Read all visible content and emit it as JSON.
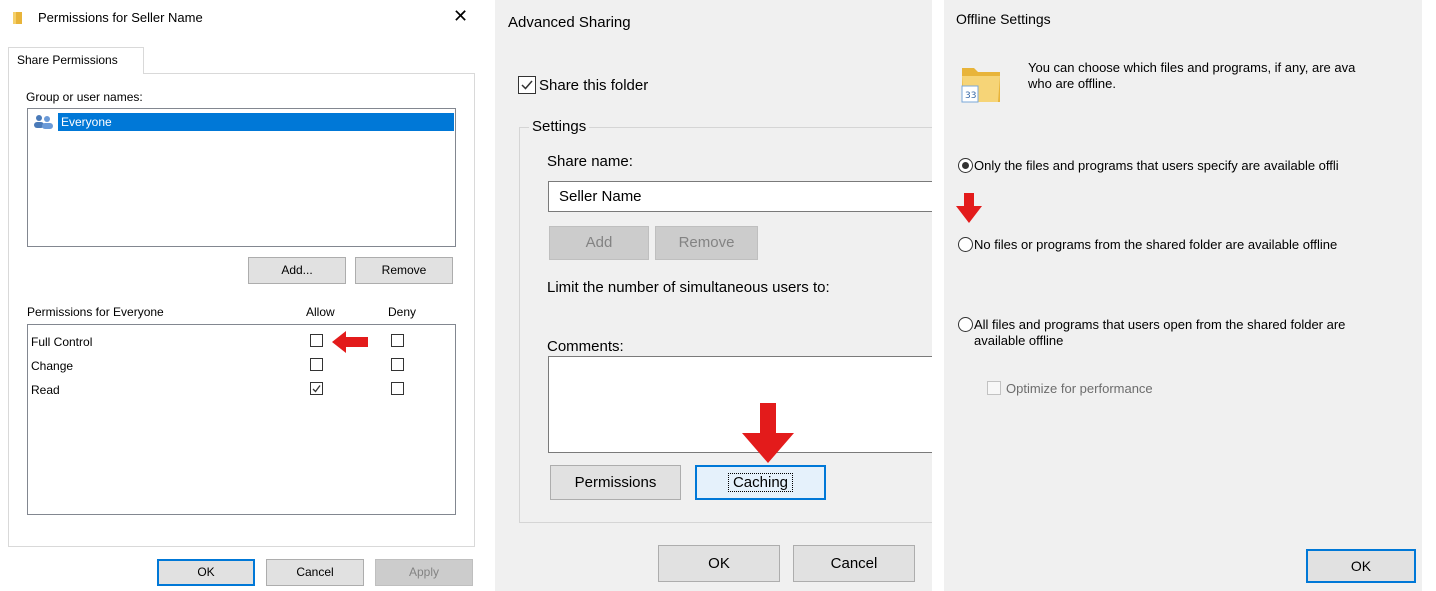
{
  "colors": {
    "accent": "#0078d7",
    "selection": "#0078d7",
    "arrow": "#e31b1b",
    "dialog_bg": "#f0f0f0"
  },
  "permissions_dialog": {
    "title": "Permissions for Seller Name",
    "title_icon": "folder-icon",
    "close_glyph": "✕",
    "tab_label": "Share Permissions",
    "group_label": "Group or user names:",
    "users": [
      {
        "name": "Everyone",
        "icon": "users-icon",
        "selected": true
      }
    ],
    "add_label": "Add...",
    "remove_label": "Remove",
    "perm_header": "Permissions for Everyone",
    "allow_header": "Allow",
    "deny_header": "Deny",
    "perms": [
      {
        "name": "Full Control",
        "allow": false,
        "deny": false
      },
      {
        "name": "Change",
        "allow": false,
        "deny": false
      },
      {
        "name": "Read",
        "allow": true,
        "deny": false
      }
    ],
    "ok_label": "OK",
    "cancel_label": "Cancel",
    "apply_label": "Apply"
  },
  "advanced_sharing": {
    "title": "Advanced Sharing",
    "share_checkbox_label": "Share this folder",
    "share_checked": true,
    "settings_label": "Settings",
    "share_name_label": "Share name:",
    "share_name_value": "Seller Name",
    "add_label": "Add",
    "remove_label": "Remove",
    "limit_label": "Limit the number of simultaneous users to:",
    "comments_label": "Comments:",
    "comments_value": "",
    "permissions_label": "Permissions",
    "caching_label": "Caching",
    "ok_label": "OK",
    "cancel_label": "Cancel"
  },
  "offline_settings": {
    "title": "Offline Settings",
    "icon": "offline-folder-icon",
    "description_line1": "You can choose which files and programs, if any, are ava",
    "description_line2": "who are offline.",
    "options": [
      {
        "line1": "Only the files and programs that users specify are available offli",
        "line2": "",
        "checked": true
      },
      {
        "line1": "No files or programs from the shared folder are available offline",
        "line2": "",
        "checked": false
      },
      {
        "line1": "All files and programs that users open from the shared folder are",
        "line2": "available offline",
        "checked": false
      }
    ],
    "optimize_label": "Optimize for performance",
    "optimize_checked": false,
    "ok_label": "OK"
  }
}
